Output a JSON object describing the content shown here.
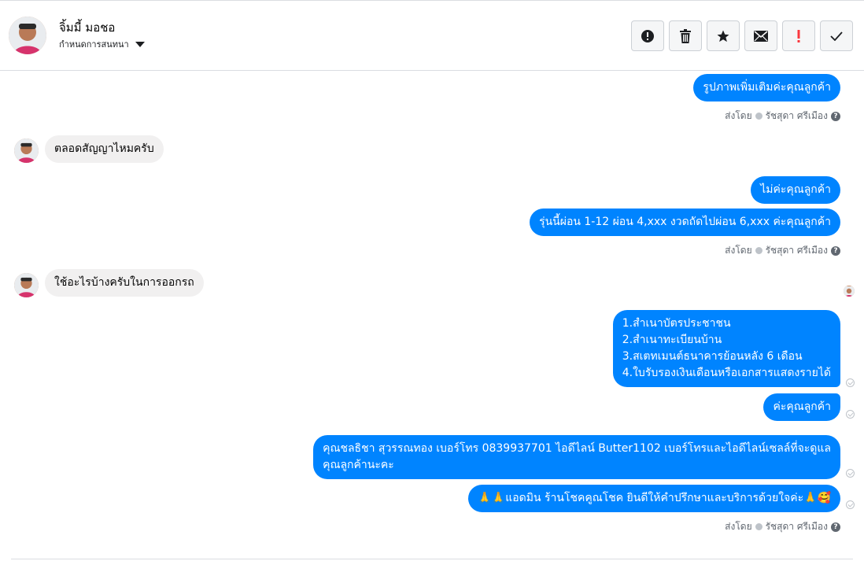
{
  "header": {
    "contact_name": "จิ้มมี้ มอชอ",
    "assign_label": "กำหนดการสนทนา",
    "actions": [
      {
        "icon": "alert-circle-icon",
        "name": "report-button"
      },
      {
        "icon": "trash-icon",
        "name": "delete-button"
      },
      {
        "icon": "star-icon",
        "name": "star-button"
      },
      {
        "icon": "envelope-icon",
        "name": "mark-unread-button"
      },
      {
        "icon": "exclamation-icon",
        "name": "spam-button"
      },
      {
        "icon": "checkmark-icon",
        "name": "done-button"
      }
    ]
  },
  "sender": {
    "sent_by_label": "ส่งโดย",
    "agent_name": "รัชสุดา ศรีเมือง"
  },
  "messages": {
    "m1": "รูปภาพเพิ่มเติมค่ะคุณลูกค้า",
    "m2": "ตลอดสัญญาไหมครับ",
    "m3": "ไม่ค่ะคุณลูกค้า",
    "m4": "รุ่นนี้ผ่อน 1-12 ผ่อน 4,xxx งวดถัดไปผ่อน 6,xxx ค่ะคุณลูกค้า",
    "m5": "ใช้อะไรบ้างครับในการออกรถ",
    "m6": "1.สำเนาบัตรประชาชน\n2.สำเนาทะเบียนบ้าน\n3.สเตทเมนต์ธนาคารย้อนหลัง 6 เดือน\n4.ใบรับรองเงินเดือนหรือเอกสารแสดงรายได้",
    "m7": "ค่ะคุณลูกค้า",
    "m8": "คุณชลธิชา สุวรรณทอง   เบอร์โทร 0839937701  ไอดีไลน์ Butter1102   เบอร์โทรและไอดีไลน์เซลล์ที่จะดูแล\nคุณลูกค้านะคะ",
    "m9": "🙏🙏แอดมิน ร้านโชคคูณโชค ยินดีให้คำปรึกษาและบริการด้วยใจค่ะ🙏🥰"
  },
  "colors": {
    "outgoing_bubble": "#0084ff",
    "incoming_bubble": "#f1f0f0"
  }
}
